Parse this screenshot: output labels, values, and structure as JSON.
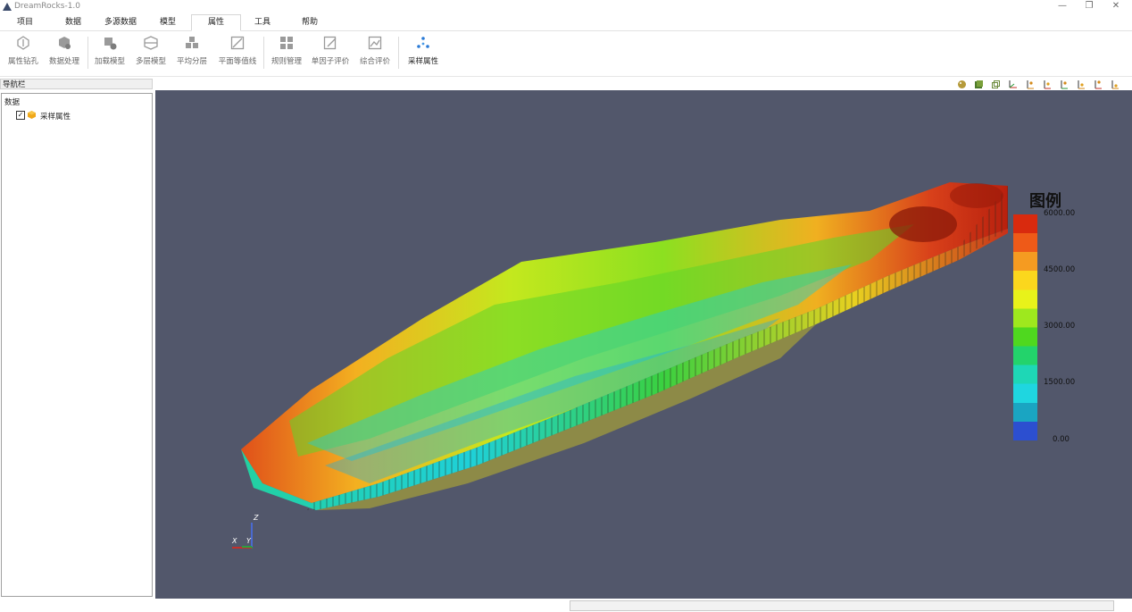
{
  "window": {
    "title": "DreamRocks-1.0",
    "minimize": "—",
    "maximize": "❐",
    "close": "✕"
  },
  "menu": {
    "tabs": [
      "项目",
      "数据",
      "多源数据",
      "模型",
      "属性",
      "工具",
      "帮助"
    ],
    "active_tab": "属性"
  },
  "ribbon": {
    "buttons": [
      {
        "label": "属性钻孔",
        "enabled": false
      },
      {
        "label": "数据处理",
        "enabled": false
      },
      {
        "label": "加载模型",
        "enabled": false
      },
      {
        "label": "多层模型",
        "enabled": false
      },
      {
        "label": "平均分层",
        "enabled": false
      },
      {
        "label": "平面等值线",
        "enabled": false
      },
      {
        "label": "规则管理",
        "enabled": false
      },
      {
        "label": "单因子评价",
        "enabled": false
      },
      {
        "label": "综合评价",
        "enabled": false
      },
      {
        "label": "采样属性",
        "enabled": true
      }
    ]
  },
  "nav": {
    "header": "导航栏",
    "root": "数据",
    "items": [
      {
        "label": "采样属性",
        "checked": true,
        "check_mark": "✓"
      }
    ]
  },
  "viewport": {
    "background": "#52576b",
    "axes": {
      "x": "X",
      "y": "Y",
      "z": "Z"
    }
  },
  "legend": {
    "title": "图例",
    "labels": [
      "6000.00",
      "4500.00",
      "3000.00",
      "1500.00",
      "0.00"
    ],
    "colors": [
      "#d92a0e",
      "#ee5a18",
      "#f59b21",
      "#fbd71d",
      "#e8f21a",
      "#9ee81e",
      "#4fd81f",
      "#23d36b",
      "#1ed7b6",
      "#1fd6e0",
      "#1aa5c2",
      "#2c4fd0"
    ]
  },
  "colors": {
    "accent": "#2a7ad6",
    "ribbon_disabled_icon": "#9a9a9a"
  }
}
